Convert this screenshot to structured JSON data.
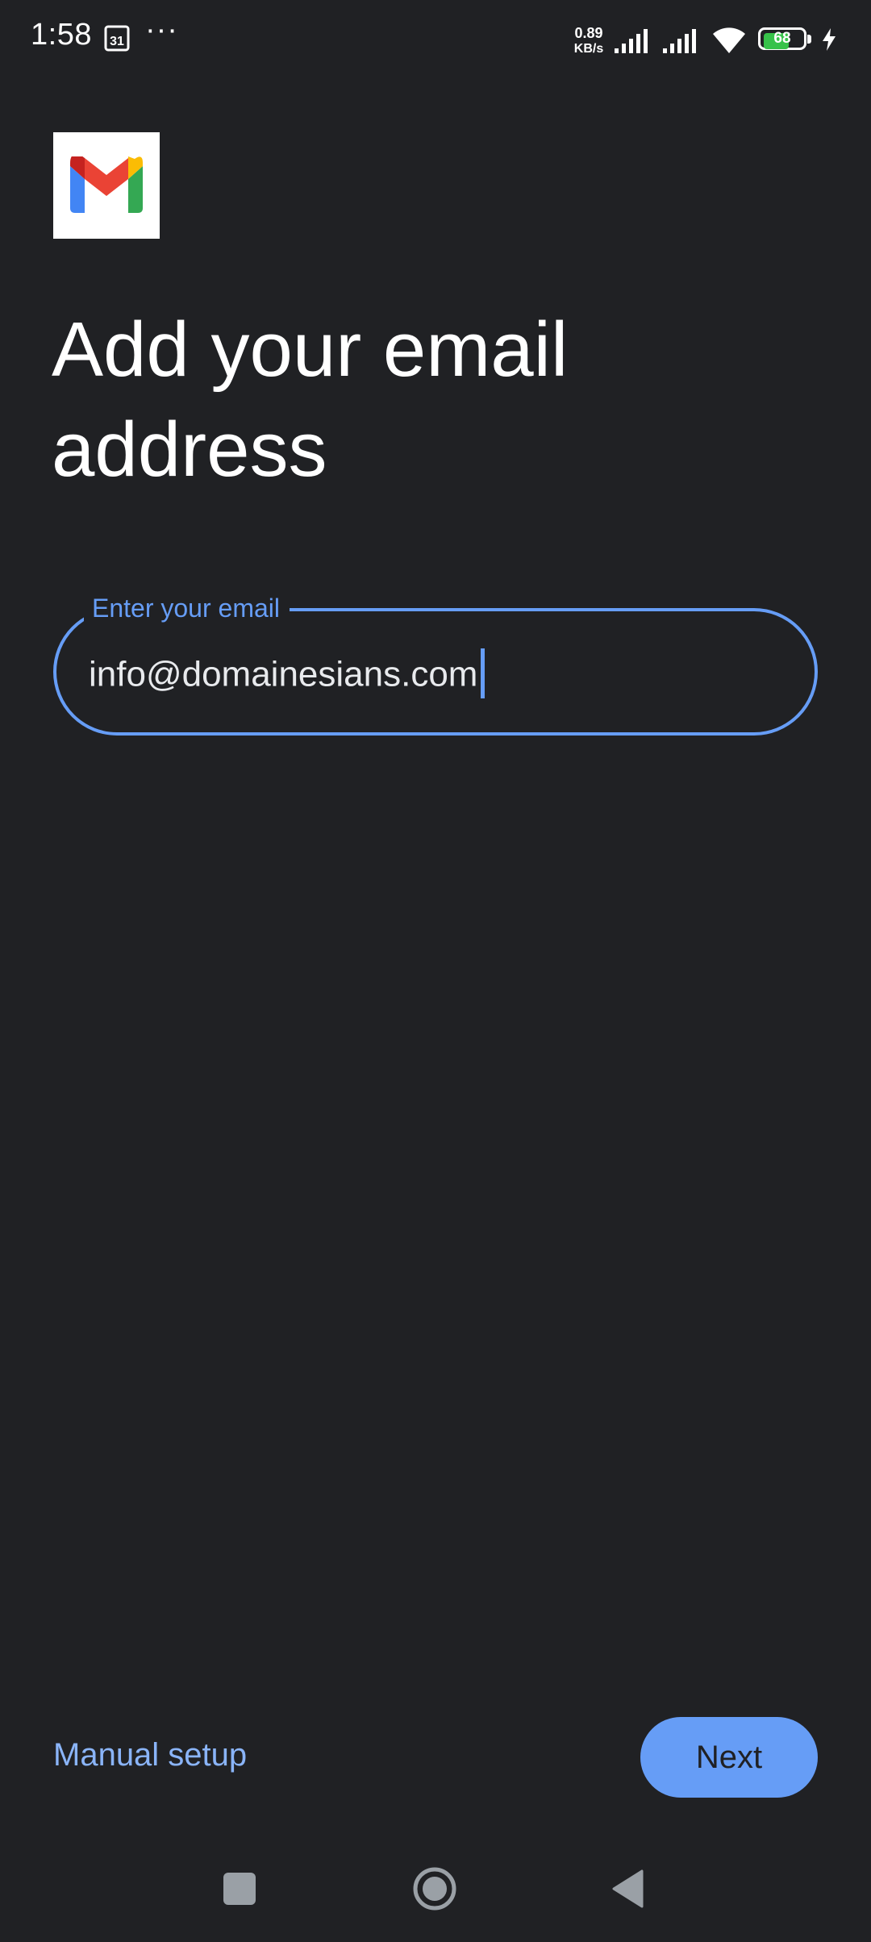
{
  "status_bar": {
    "time": "1:58",
    "calendar_day": "31",
    "more": "···",
    "net_speed_value": "0.89",
    "net_speed_unit": "KB/s",
    "battery_level": 68,
    "battery_text": "68"
  },
  "header": {
    "logo_icon": "gmail-logo-icon",
    "title": "Add your email address"
  },
  "email_field": {
    "label": "Enter your email",
    "value": "info@domainesians.com"
  },
  "actions": {
    "manual_setup_label": "Manual setup",
    "next_label": "Next"
  },
  "nav_bar": {
    "recents_icon": "square-icon",
    "home_icon": "circle-icon",
    "back_icon": "triangle-back-icon"
  },
  "colors": {
    "background": "#202124",
    "accent": "#669df6",
    "link": "#8ab4f8",
    "battery": "#37c24a"
  }
}
